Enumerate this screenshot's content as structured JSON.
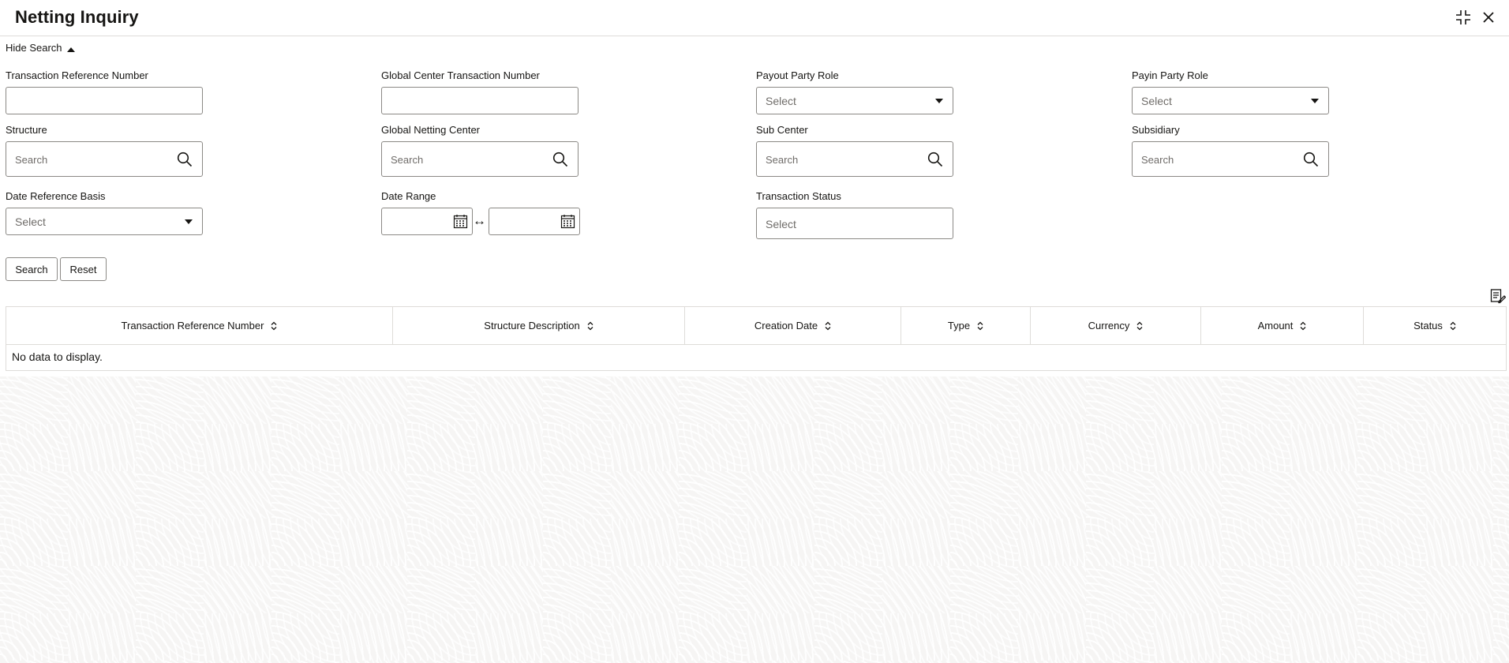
{
  "header": {
    "title": "Netting Inquiry",
    "icons": [
      "collapse-icon",
      "close-icon"
    ]
  },
  "search_toggle": {
    "label": "Hide Search",
    "icon": "caret-up-icon"
  },
  "fields": {
    "transaction_reference_number": {
      "label": "Transaction Reference Number",
      "value": ""
    },
    "global_center_transaction_number": {
      "label": "Global Center Transaction Number",
      "value": ""
    },
    "payout_party_role": {
      "label": "Payout Party Role",
      "value": "Select"
    },
    "payin_party_role": {
      "label": "Payin Party Role",
      "value": "Select"
    },
    "structure": {
      "label": "Structure",
      "placeholder": "Search"
    },
    "global_netting_center": {
      "label": "Global Netting Center",
      "placeholder": "Search"
    },
    "sub_center": {
      "label": "Sub Center",
      "placeholder": "Search"
    },
    "subsidiary": {
      "label": "Subsidiary",
      "placeholder": "Search"
    },
    "date_reference_basis": {
      "label": "Date Reference Basis",
      "value": "Select"
    },
    "date_range": {
      "label": "Date Range",
      "from": "",
      "to": "",
      "separator": "↔"
    },
    "transaction_status": {
      "label": "Transaction Status",
      "value": "Select"
    }
  },
  "buttons": {
    "search": "Search",
    "reset": "Reset"
  },
  "table": {
    "columns": [
      "Transaction Reference Number",
      "Structure Description",
      "Creation Date",
      "Type",
      "Currency",
      "Amount",
      "Status"
    ],
    "empty_text": "No data to display.",
    "rows": []
  },
  "colors": {
    "border": "#8b8985",
    "divider": "#dedcd9",
    "text": "#161513",
    "placeholder": "#6f6c69"
  }
}
